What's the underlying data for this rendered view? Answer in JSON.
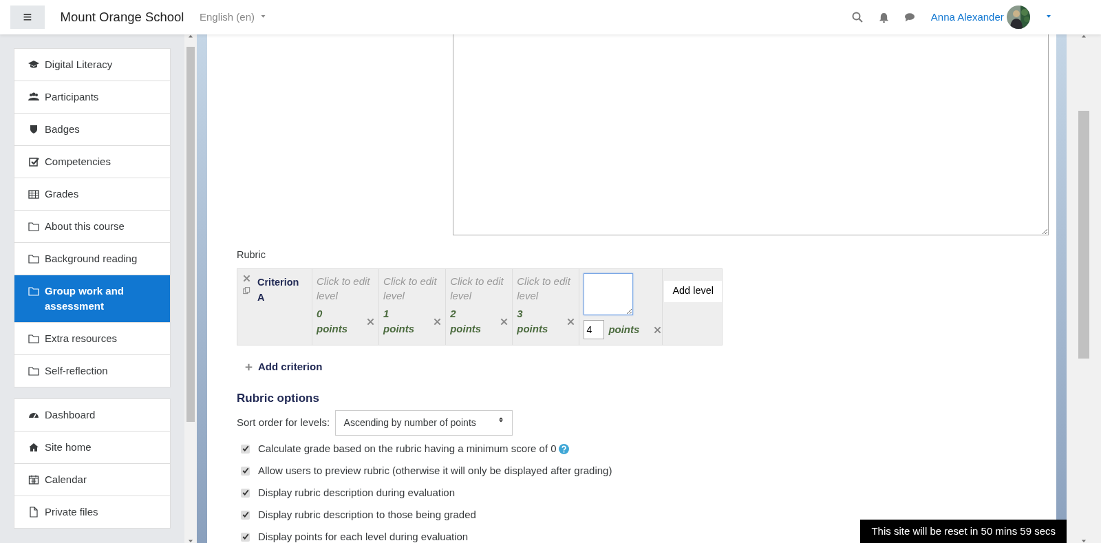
{
  "navbar": {
    "menu_button": "≡",
    "site_name": "Mount Orange School",
    "language": "English (en)",
    "user_name": "Anna Alexander"
  },
  "sidebar": {
    "course_items": [
      {
        "label": "Digital Literacy",
        "selected": false
      },
      {
        "label": "Participants",
        "selected": false
      },
      {
        "label": "Badges",
        "selected": false
      },
      {
        "label": "Competencies",
        "selected": false
      },
      {
        "label": "Grades",
        "selected": false
      },
      {
        "label": "About this course",
        "selected": false
      },
      {
        "label": "Background reading",
        "selected": false
      },
      {
        "label": "Group work and assessment",
        "selected": true
      },
      {
        "label": "Extra resources",
        "selected": false
      },
      {
        "label": "Self-reflection",
        "selected": false
      }
    ],
    "site_items": [
      {
        "label": "Dashboard",
        "selected": false
      },
      {
        "label": "Site home",
        "selected": false
      },
      {
        "label": "Calendar",
        "selected": false
      },
      {
        "label": "Private files",
        "selected": false
      }
    ]
  },
  "rubric": {
    "label": "Rubric",
    "criteria": [
      {
        "name": "Criterion A",
        "levels": [
          {
            "kind": "view",
            "definition": "Click to edit level",
            "score": "0 points"
          },
          {
            "kind": "view",
            "definition": "Click to edit level",
            "score": "1 points"
          },
          {
            "kind": "view",
            "definition": "Click to edit level",
            "score": "2 points"
          },
          {
            "kind": "view",
            "definition": "Click to edit level",
            "score": "3 points"
          },
          {
            "kind": "editing",
            "score_value": "4",
            "score_unit": "points"
          }
        ],
        "add_level": "Add level"
      }
    ],
    "add_criterion": "Add criterion"
  },
  "rubric_options": {
    "heading": "Rubric options",
    "sort_label": "Sort order for levels:",
    "sort_value": "Ascending by number of points",
    "options": [
      {
        "label": "Calculate grade based on the rubric having a minimum score of 0",
        "checked": true,
        "help": true
      },
      {
        "label": "Allow users to preview rubric (otherwise it will only be displayed after grading)",
        "checked": true
      },
      {
        "label": "Display rubric description during evaluation",
        "checked": true
      },
      {
        "label": "Display rubric description to those being graded",
        "checked": true
      },
      {
        "label": "Display points for each level during evaluation",
        "checked": true
      }
    ]
  },
  "reset_notice": "This site will be reset in 50 mins 59 secs"
}
